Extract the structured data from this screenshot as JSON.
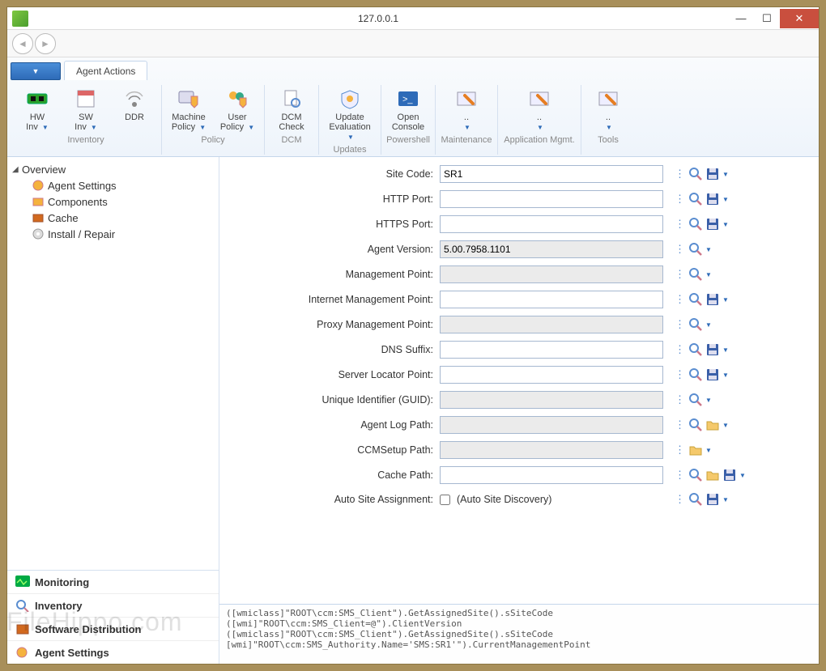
{
  "window": {
    "title": "127.0.0.1"
  },
  "ribbon": {
    "tab": "Agent Actions",
    "groups": {
      "inventory": {
        "label": "Inventory",
        "hw": "HW\nInv ▾",
        "sw": "SW\nInv ▾",
        "ddr": "DDR"
      },
      "policy": {
        "label": "Policy",
        "machine": "Machine\nPolicy ▾",
        "user": "User\nPolicy ▾"
      },
      "dcm": {
        "label": "DCM",
        "check": "DCM\nCheck"
      },
      "updates": {
        "label": "Updates",
        "eval": "Update\nEvaluation ▾"
      },
      "ps": {
        "label": "Powershell",
        "open": "Open\nConsole"
      },
      "maint": {
        "label": "Maintenance",
        "btn": "..\n▾"
      },
      "appmgmt": {
        "label": "Application Mgmt.",
        "btn": "..\n▾"
      },
      "tools": {
        "label": "Tools",
        "btn": "..\n▾"
      }
    }
  },
  "tree": {
    "root": "Overview",
    "items": [
      "Agent Settings",
      "Components",
      "Cache",
      "Install / Repair"
    ]
  },
  "bottom_nav": [
    "Monitoring",
    "Inventory",
    "Software Distribution",
    "Agent Settings"
  ],
  "form": {
    "rows": [
      {
        "label": "Site Code:",
        "value": "SR1",
        "readonly": false,
        "actions": [
          "search",
          "save"
        ]
      },
      {
        "label": "HTTP Port:",
        "value": "",
        "readonly": false,
        "actions": [
          "search",
          "save"
        ]
      },
      {
        "label": "HTTPS Port:",
        "value": "",
        "readonly": false,
        "actions": [
          "search",
          "save"
        ]
      },
      {
        "label": "Agent Version:",
        "value": "5.00.7958.1101",
        "readonly": true,
        "actions": [
          "search"
        ]
      },
      {
        "label": "Management Point:",
        "value": "",
        "readonly": true,
        "actions": [
          "search"
        ]
      },
      {
        "label": "Internet Management Point:",
        "value": "",
        "readonly": false,
        "actions": [
          "search",
          "save"
        ]
      },
      {
        "label": "Proxy Management Point:",
        "value": "",
        "readonly": true,
        "actions": [
          "search"
        ]
      },
      {
        "label": "DNS Suffix:",
        "value": "",
        "readonly": false,
        "actions": [
          "search",
          "save"
        ]
      },
      {
        "label": "Server Locator Point:",
        "value": "",
        "readonly": false,
        "actions": [
          "search",
          "save"
        ]
      },
      {
        "label": "Unique Identifier (GUID):",
        "value": "",
        "readonly": true,
        "actions": [
          "search"
        ]
      },
      {
        "label": "Agent Log Path:",
        "value": "",
        "readonly": true,
        "actions": [
          "search",
          "folder"
        ]
      },
      {
        "label": "CCMSetup Path:",
        "value": "",
        "readonly": true,
        "actions": [
          "folder"
        ]
      },
      {
        "label": "Cache Path:",
        "value": "",
        "readonly": false,
        "actions": [
          "search",
          "folder",
          "save"
        ]
      }
    ],
    "auto_site": {
      "label": "Auto Site Assignment:",
      "text": "(Auto Site Discovery)",
      "actions": [
        "search",
        "save"
      ]
    }
  },
  "console": {
    "lines": [
      "([wmiclass]\"ROOT\\ccm:SMS_Client\").GetAssignedSite().sSiteCode",
      "([wmi]\"ROOT\\ccm:SMS_Client=@\").ClientVersion",
      "([wmiclass]\"ROOT\\ccm:SMS_Client\").GetAssignedSite().sSiteCode",
      "[wmi]\"ROOT\\ccm:SMS_Authority.Name='SMS:SR1'\").CurrentManagementPoint"
    ]
  },
  "watermark": "FileHippo.com"
}
